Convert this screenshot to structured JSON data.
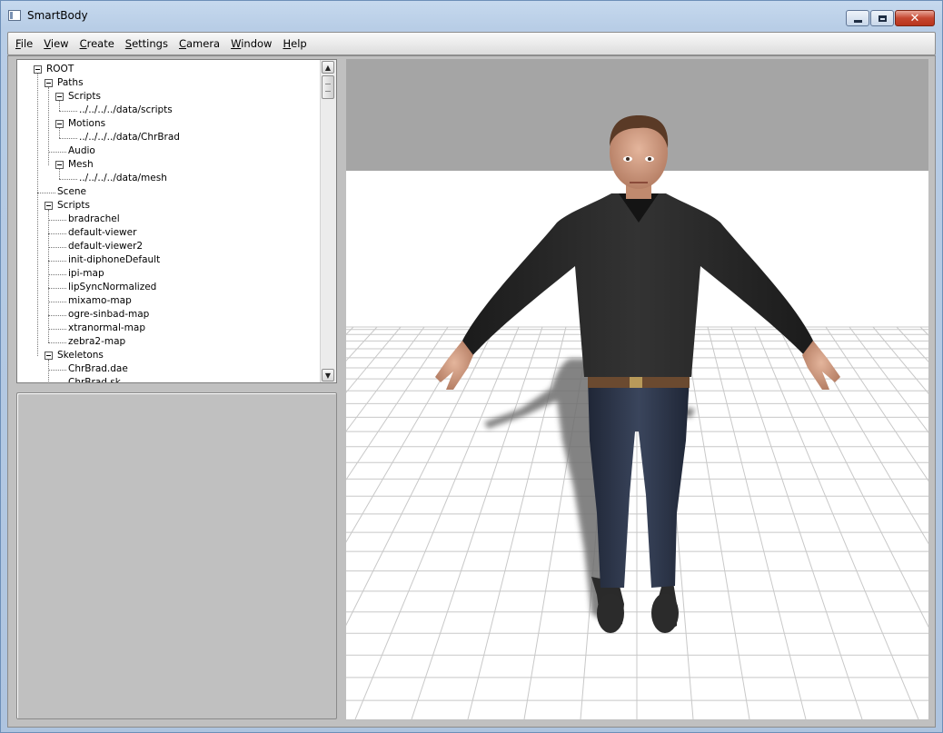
{
  "window": {
    "title": "SmartBody",
    "minimize_glyph": "",
    "maximize_glyph": "",
    "close_glyph": "✕"
  },
  "menubar": {
    "items": [
      {
        "label_first": "F",
        "label_rest": "ile"
      },
      {
        "label_first": "V",
        "label_rest": "iew"
      },
      {
        "label_first": "C",
        "label_rest": "reate"
      },
      {
        "label_first": "S",
        "label_rest": "ettings"
      },
      {
        "label_first": "C",
        "label_rest": "amera"
      },
      {
        "label_first": "W",
        "label_rest": "indow"
      },
      {
        "label_first": "H",
        "label_rest": "elp"
      }
    ]
  },
  "tree": {
    "rows": [
      {
        "label": "ROOT",
        "level": 0,
        "expander": true
      },
      {
        "label": "Paths",
        "level": 1,
        "expander": true
      },
      {
        "label": "Scripts",
        "level": 2,
        "expander": true
      },
      {
        "label": "../../../../data/scripts",
        "level": 3,
        "expander": false
      },
      {
        "label": "Motions",
        "level": 2,
        "expander": true
      },
      {
        "label": "../../../../data/ChrBrad",
        "level": 3,
        "expander": false
      },
      {
        "label": "Audio",
        "level": 2,
        "expander": false
      },
      {
        "label": "Mesh",
        "level": 2,
        "expander": true
      },
      {
        "label": "../../../../data/mesh",
        "level": 3,
        "expander": false
      },
      {
        "label": "Scene",
        "level": 1,
        "expander": false
      },
      {
        "label": "Scripts",
        "level": 1,
        "expander": true
      },
      {
        "label": "bradrachel",
        "level": 2,
        "expander": false
      },
      {
        "label": "default-viewer",
        "level": 2,
        "expander": false
      },
      {
        "label": "default-viewer2",
        "level": 2,
        "expander": false
      },
      {
        "label": "init-diphoneDefault",
        "level": 2,
        "expander": false
      },
      {
        "label": "ipi-map",
        "level": 2,
        "expander": false
      },
      {
        "label": "lipSyncNormalized",
        "level": 2,
        "expander": false
      },
      {
        "label": "mixamo-map",
        "level": 2,
        "expander": false
      },
      {
        "label": "ogre-sinbad-map",
        "level": 2,
        "expander": false
      },
      {
        "label": "xtranormal-map",
        "level": 2,
        "expander": false
      },
      {
        "label": "zebra2-map",
        "level": 2,
        "expander": false
      },
      {
        "label": "Skeletons",
        "level": 1,
        "expander": true
      },
      {
        "label": "ChrBrad.dae",
        "level": 2,
        "expander": false
      },
      {
        "label": "ChrBrad.sk",
        "level": 2,
        "expander": false
      }
    ]
  },
  "scrollbar": {
    "up_glyph": "▲",
    "down_glyph": "▼"
  },
  "viewport": {
    "sky_color": "#a5a5a5",
    "floor_color": "#ffffff",
    "grid_color": "#c8c8c8",
    "character": "character-figure"
  }
}
